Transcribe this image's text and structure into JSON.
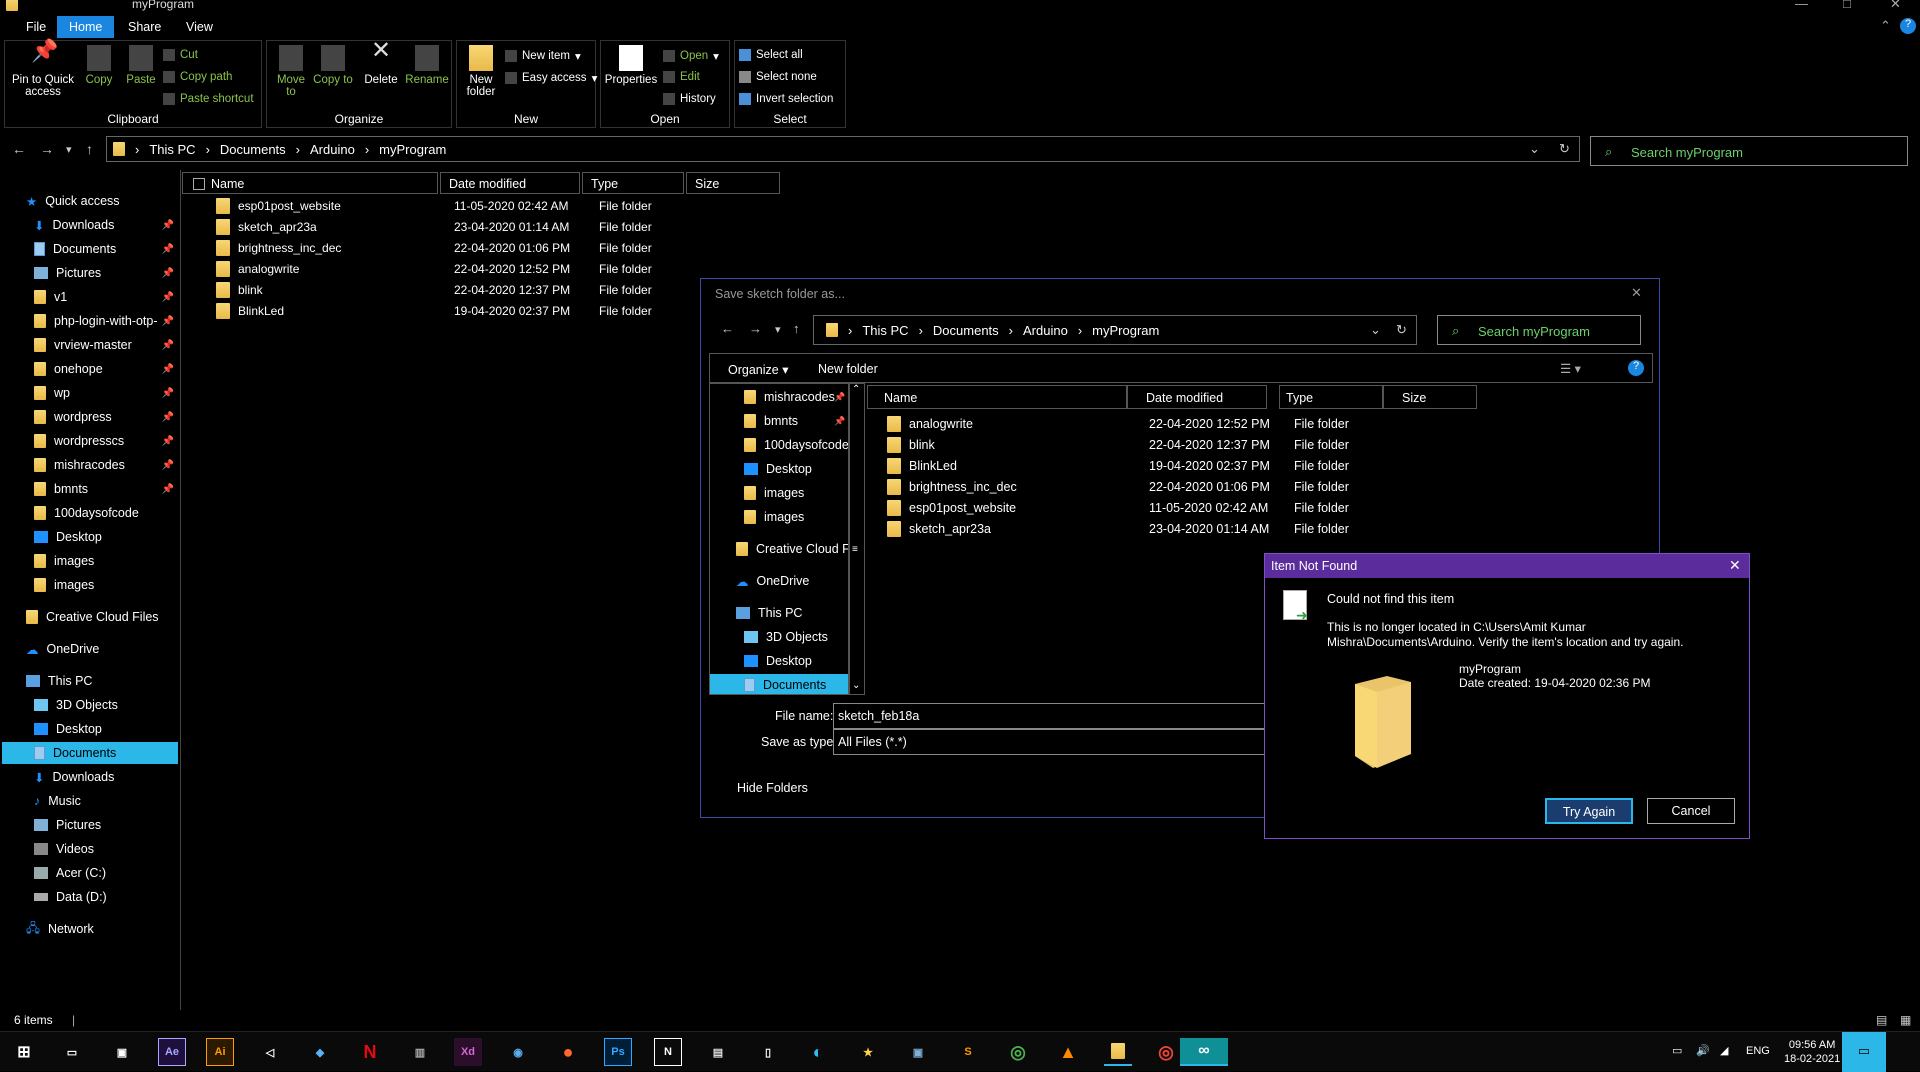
{
  "window": {
    "title": "myProgram"
  },
  "ribbon": {
    "tabs": [
      "File",
      "Home",
      "Share",
      "View"
    ],
    "clipboard": {
      "label": "Clipboard",
      "pin": "Pin to Quick access",
      "copy": "Copy",
      "paste": "Paste",
      "cut": "Cut",
      "copy_path": "Copy path",
      "paste_shortcut": "Paste shortcut"
    },
    "organize": {
      "label": "Organize",
      "move_to": "Move to",
      "copy_to": "Copy to",
      "delete": "Delete",
      "rename": "Rename"
    },
    "new": {
      "label": "New",
      "new_folder": "New folder",
      "new_item": "New item",
      "easy_access": "Easy access"
    },
    "open": {
      "label": "Open",
      "properties": "Properties",
      "open": "Open",
      "edit": "Edit",
      "history": "History"
    },
    "select": {
      "label": "Select",
      "select_all": "Select all",
      "select_none": "Select none",
      "invert": "Invert selection"
    }
  },
  "nav": {
    "breadcrumb": [
      "This PC",
      "Documents",
      "Arduino",
      "myProgram"
    ],
    "search_placeholder": "Search myProgram"
  },
  "tree": {
    "quick_access": "Quick access",
    "items": [
      {
        "label": "Downloads",
        "pinned": true
      },
      {
        "label": "Documents",
        "pinned": true
      },
      {
        "label": "Pictures",
        "pinned": true
      },
      {
        "label": "v1",
        "pinned": true
      },
      {
        "label": "php-login-with-otp-",
        "pinned": true
      },
      {
        "label": "vrview-master",
        "pinned": true
      },
      {
        "label": "onehope",
        "pinned": true
      },
      {
        "label": "wp",
        "pinned": true
      },
      {
        "label": "wordpress",
        "pinned": true
      },
      {
        "label": "wordpresscs",
        "pinned": true
      },
      {
        "label": "mishracodes",
        "pinned": true
      },
      {
        "label": "bmnts",
        "pinned": true
      },
      {
        "label": "100daysofcode",
        "pinned": false
      },
      {
        "label": "Desktop",
        "pinned": false
      },
      {
        "label": "images",
        "pinned": false
      },
      {
        "label": "images",
        "pinned": false
      }
    ],
    "creative_cloud": "Creative Cloud Files",
    "onedrive": "OneDrive",
    "this_pc": "This PC",
    "pc_items": [
      "3D Objects",
      "Desktop",
      "Documents",
      "Downloads",
      "Music",
      "Pictures",
      "Videos",
      "Acer (C:)",
      "Data (D:)"
    ],
    "network": "Network"
  },
  "filelist": {
    "columns": [
      "Name",
      "Date modified",
      "Type",
      "Size"
    ],
    "rows": [
      {
        "name": "esp01post_website",
        "date": "11-05-2020 02:42 AM",
        "type": "File folder"
      },
      {
        "name": "sketch_apr23a",
        "date": "23-04-2020 01:14 AM",
        "type": "File folder"
      },
      {
        "name": "brightness_inc_dec",
        "date": "22-04-2020 01:06 PM",
        "type": "File folder"
      },
      {
        "name": "analogwrite",
        "date": "22-04-2020 12:52 PM",
        "type": "File folder"
      },
      {
        "name": "blink",
        "date": "22-04-2020 12:37 PM",
        "type": "File folder"
      },
      {
        "name": "BlinkLed",
        "date": "19-04-2020 02:37 PM",
        "type": "File folder"
      }
    ]
  },
  "save_dialog": {
    "title": "Save sketch folder as...",
    "breadcrumb": [
      "This PC",
      "Documents",
      "Arduino",
      "myProgram"
    ],
    "search_placeholder": "Search myProgram",
    "organize": "Organize",
    "new_folder": "New folder",
    "tree": [
      "mishracodes",
      "bmnts",
      "100daysofcode",
      "Desktop",
      "images",
      "images",
      "Creative Cloud Fil",
      "OneDrive",
      "This PC",
      "3D Objects",
      "Desktop",
      "Documents"
    ],
    "columns": [
      "Name",
      "Date modified",
      "Type",
      "Size"
    ],
    "rows": [
      {
        "name": "analogwrite",
        "date": "22-04-2020 12:52 PM",
        "type": "File folder"
      },
      {
        "name": "blink",
        "date": "22-04-2020 12:37 PM",
        "type": "File folder"
      },
      {
        "name": "BlinkLed",
        "date": "19-04-2020 02:37 PM",
        "type": "File folder"
      },
      {
        "name": "brightness_inc_dec",
        "date": "22-04-2020 01:06 PM",
        "type": "File folder"
      },
      {
        "name": "esp01post_website",
        "date": "11-05-2020 02:42 AM",
        "type": "File folder"
      },
      {
        "name": "sketch_apr23a",
        "date": "23-04-2020 01:14 AM",
        "type": "File folder"
      }
    ],
    "file_name_label": "File name:",
    "file_name_value": "sketch_feb18a",
    "save_type_label": "Save as type:",
    "save_type_value": "All Files (*.*)",
    "hide_folders": "Hide Folders"
  },
  "error_dialog": {
    "title": "Item Not Found",
    "heading": "Could not find this item",
    "message": "This is no longer located in C:\\Users\\Amit Kumar Mishra\\Documents\\Arduino. Verify the item's location and try again.",
    "item_name": "myProgram",
    "item_date": "Date created: 19-04-2020 02:36 PM",
    "try_again": "Try Again",
    "cancel": "Cancel"
  },
  "status": {
    "items": "6 items"
  },
  "taskbar": {
    "apps": [
      "Ae",
      "Ai",
      "Ps"
    ],
    "tray": {
      "lang": "ENG",
      "time": "09:56 AM",
      "date": "18-02-2021"
    }
  },
  "colors": {
    "accent": "#2bb8e8",
    "error_title": "#5a2c9c",
    "search_text": "#6bd06b"
  }
}
